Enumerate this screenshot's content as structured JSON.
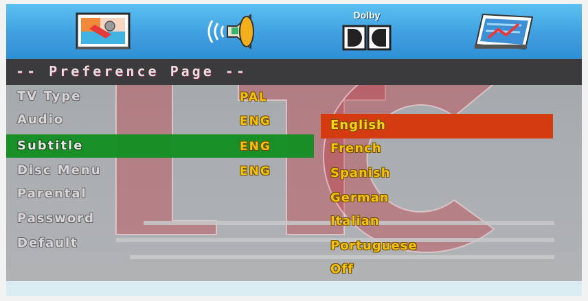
{
  "tabs": [
    {
      "name": "general-setup",
      "icon": "tv-wrench-icon"
    },
    {
      "name": "audio-setup",
      "icon": "speaker-icon"
    },
    {
      "name": "dolby-setup",
      "icon": "dolby-icon",
      "label": "Dolby"
    },
    {
      "name": "preference-setup",
      "icon": "preference-chart-icon"
    }
  ],
  "page": {
    "title": "-- Preference Page --"
  },
  "menu": [
    {
      "label": "TV Type",
      "value": "PAL"
    },
    {
      "label": "Audio",
      "value": "ENG"
    },
    {
      "label": "Subtitle",
      "value": "ENG"
    },
    {
      "label": "Disc Menu",
      "value": "ENG"
    },
    {
      "label": "Parental",
      "value": ""
    },
    {
      "label": "Password",
      "value": ""
    },
    {
      "label": "Default",
      "value": ""
    }
  ],
  "selected_row": "Subtitle",
  "options": [
    "English",
    "French",
    "Spanish",
    "German",
    "Italian",
    "Portuguese",
    "Off"
  ],
  "selected_option": "English",
  "watermark": "LTC",
  "colors": {
    "top_bar": "#3f9fe0",
    "title_bar": "#3b3b3e",
    "highlight_row": "#138e22",
    "highlight_option": "#d43c10",
    "value_text": "#f4c10a",
    "watermark": "#c0414a"
  }
}
